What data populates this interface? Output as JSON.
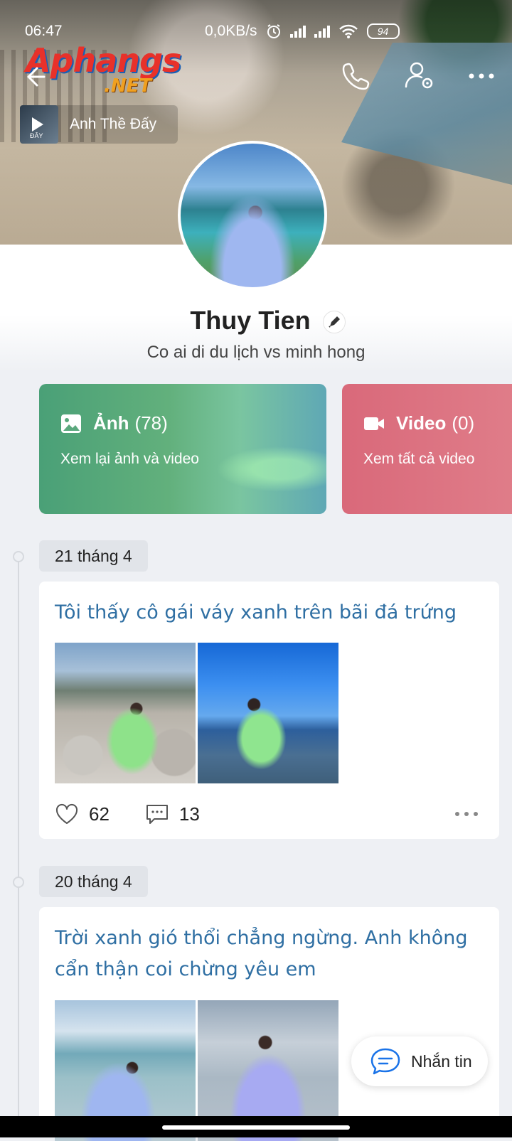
{
  "status_bar": {
    "time": "06:47",
    "net_speed": "0,0KB/s",
    "battery": "94"
  },
  "watermark": {
    "main": "Aphangs",
    "sub": ".NET"
  },
  "music": {
    "thumb_label": "ĐÂY",
    "title": "Anh Thề Đấy"
  },
  "profile": {
    "name": "Thuy Tien",
    "bio": "Co ai di du lịch vs minh hong"
  },
  "albums": {
    "photos": {
      "label": "Ảnh",
      "count": "(78)",
      "subtitle": "Xem lại ảnh và video"
    },
    "videos": {
      "label": "Video",
      "count": "(0)",
      "subtitle": "Xem tất cả video"
    }
  },
  "posts": [
    {
      "date": "21 tháng 4",
      "text": "Tôi thấy cô gái váy xanh trên bãi đá trứng",
      "likes": "62",
      "comments": "13"
    },
    {
      "date": "20 tháng 4",
      "text": "Trời xanh gió thổi chẳng ngừng. Anh không cẩn thận coi chừng yêu em"
    }
  ],
  "fab": {
    "label": "Nhắn tin"
  },
  "colors": {
    "photos_card": "#4aa077",
    "videos_card": "#d9697a",
    "post_text": "#2f6fa3",
    "fab_accent": "#1a73e8"
  },
  "icons": {
    "back": "back-arrow-icon",
    "call": "phone-icon",
    "settings": "user-settings-icon",
    "more": "more-horizontal-icon",
    "photo": "image-icon",
    "video": "video-camera-icon",
    "like": "heart-icon",
    "comment": "comment-icon",
    "message": "chat-bubble-icon"
  }
}
